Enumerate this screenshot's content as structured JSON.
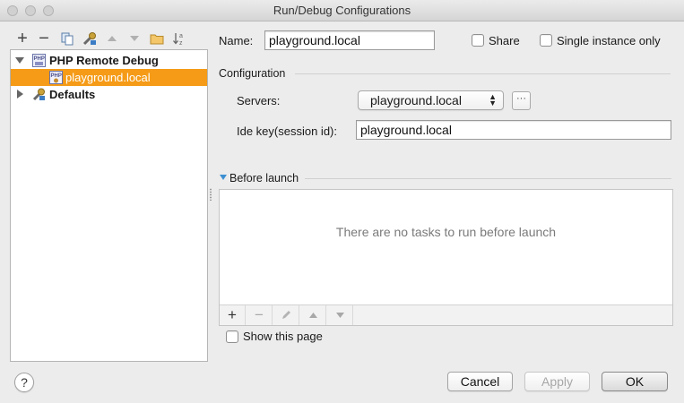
{
  "window": {
    "title": "Run/Debug Configurations"
  },
  "toolbar": {
    "items": [
      "add-icon",
      "remove-icon",
      "copy-icon",
      "edit-defaults-icon",
      "move-up-icon",
      "move-down-icon",
      "folder-icon",
      "sort-icon"
    ],
    "add_label": "+",
    "remove_label": "−"
  },
  "tree": {
    "group": {
      "label": "PHP Remote Debug",
      "icon": "php-icon",
      "expanded": true
    },
    "selected_item": {
      "label": "playground.local",
      "icon": "php-config-icon"
    },
    "defaults": {
      "label": "Defaults",
      "icon": "wrench-icon",
      "expanded": false
    }
  },
  "form": {
    "name_label": "Name:",
    "name_value": "playground.local",
    "share_label": "Share",
    "single_instance_label": "Single instance only",
    "configuration_title": "Configuration",
    "servers_label": "Servers:",
    "servers_value": "playground.local",
    "servers_more": "···",
    "ide_key_label": "Ide key(session id):",
    "ide_key_value": "playground.local",
    "before_launch_title": "Before launch",
    "no_tasks_message": "There are no tasks to run before launch",
    "show_page_label": "Show this page"
  },
  "task_buttons": {
    "add": "+",
    "remove": "−"
  },
  "buttons": {
    "help": "?",
    "cancel": "Cancel",
    "apply": "Apply",
    "ok": "OK"
  },
  "colors": {
    "selection": "#f59b17",
    "window_bg": "#ececec",
    "accent_triangle": "#3d8fd1"
  }
}
